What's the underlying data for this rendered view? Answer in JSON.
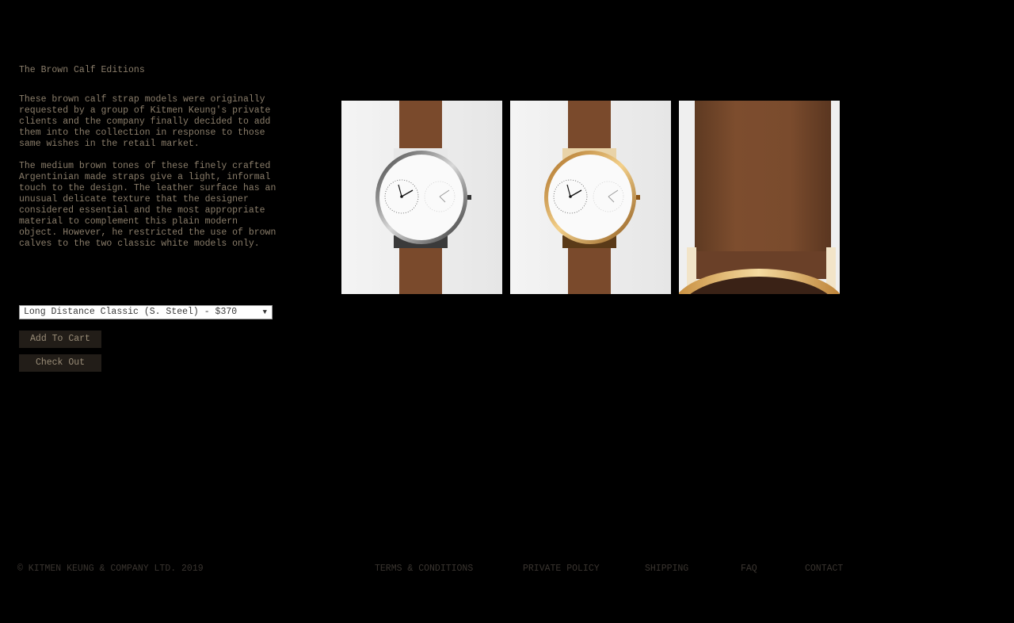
{
  "product": {
    "title": "The Brown Calf Editions",
    "description": [
      "These brown calf strap models were originally requested by a group of Kitmen Keung's private clients and the company finally decided to add them into the collection in response to those same wishes in the retail market.",
      "The medium brown tones of these finely crafted Argentinian made straps give a light, informal touch to the design. The leather surface has an unusual delicate texture that the designer considered essential and the most appropriate material to complement this plain modern object. However, he restricted the use of brown calves to the two classic white models only."
    ],
    "variant_selected": "Long Distance Classic (S. Steel) - $370",
    "add_to_cart_label": "Add To Cart",
    "checkout_label": "Check Out"
  },
  "gallery": [
    {
      "name": "steel-watch-photo",
      "case_color": "#c8c8c8"
    },
    {
      "name": "gold-watch-photo",
      "case_color": "#d9a35a"
    },
    {
      "name": "strap-closeup-photo",
      "case_color": "#e2b567"
    }
  ],
  "colors": {
    "background": "#000000",
    "text": "#8a7d6a",
    "button_bg": "#221d18",
    "footer_text": "#3a3530",
    "strap": "#7a4a2c"
  },
  "footer": {
    "copyright": "© KITMEN KEUNG & COMPANY LTD. 2019",
    "links": {
      "terms": "TERMS & CONDITIONS",
      "privacy": "PRIVATE POLICY",
      "shipping": "SHIPPING",
      "faq": "FAQ",
      "contact": "CONTACT"
    }
  }
}
